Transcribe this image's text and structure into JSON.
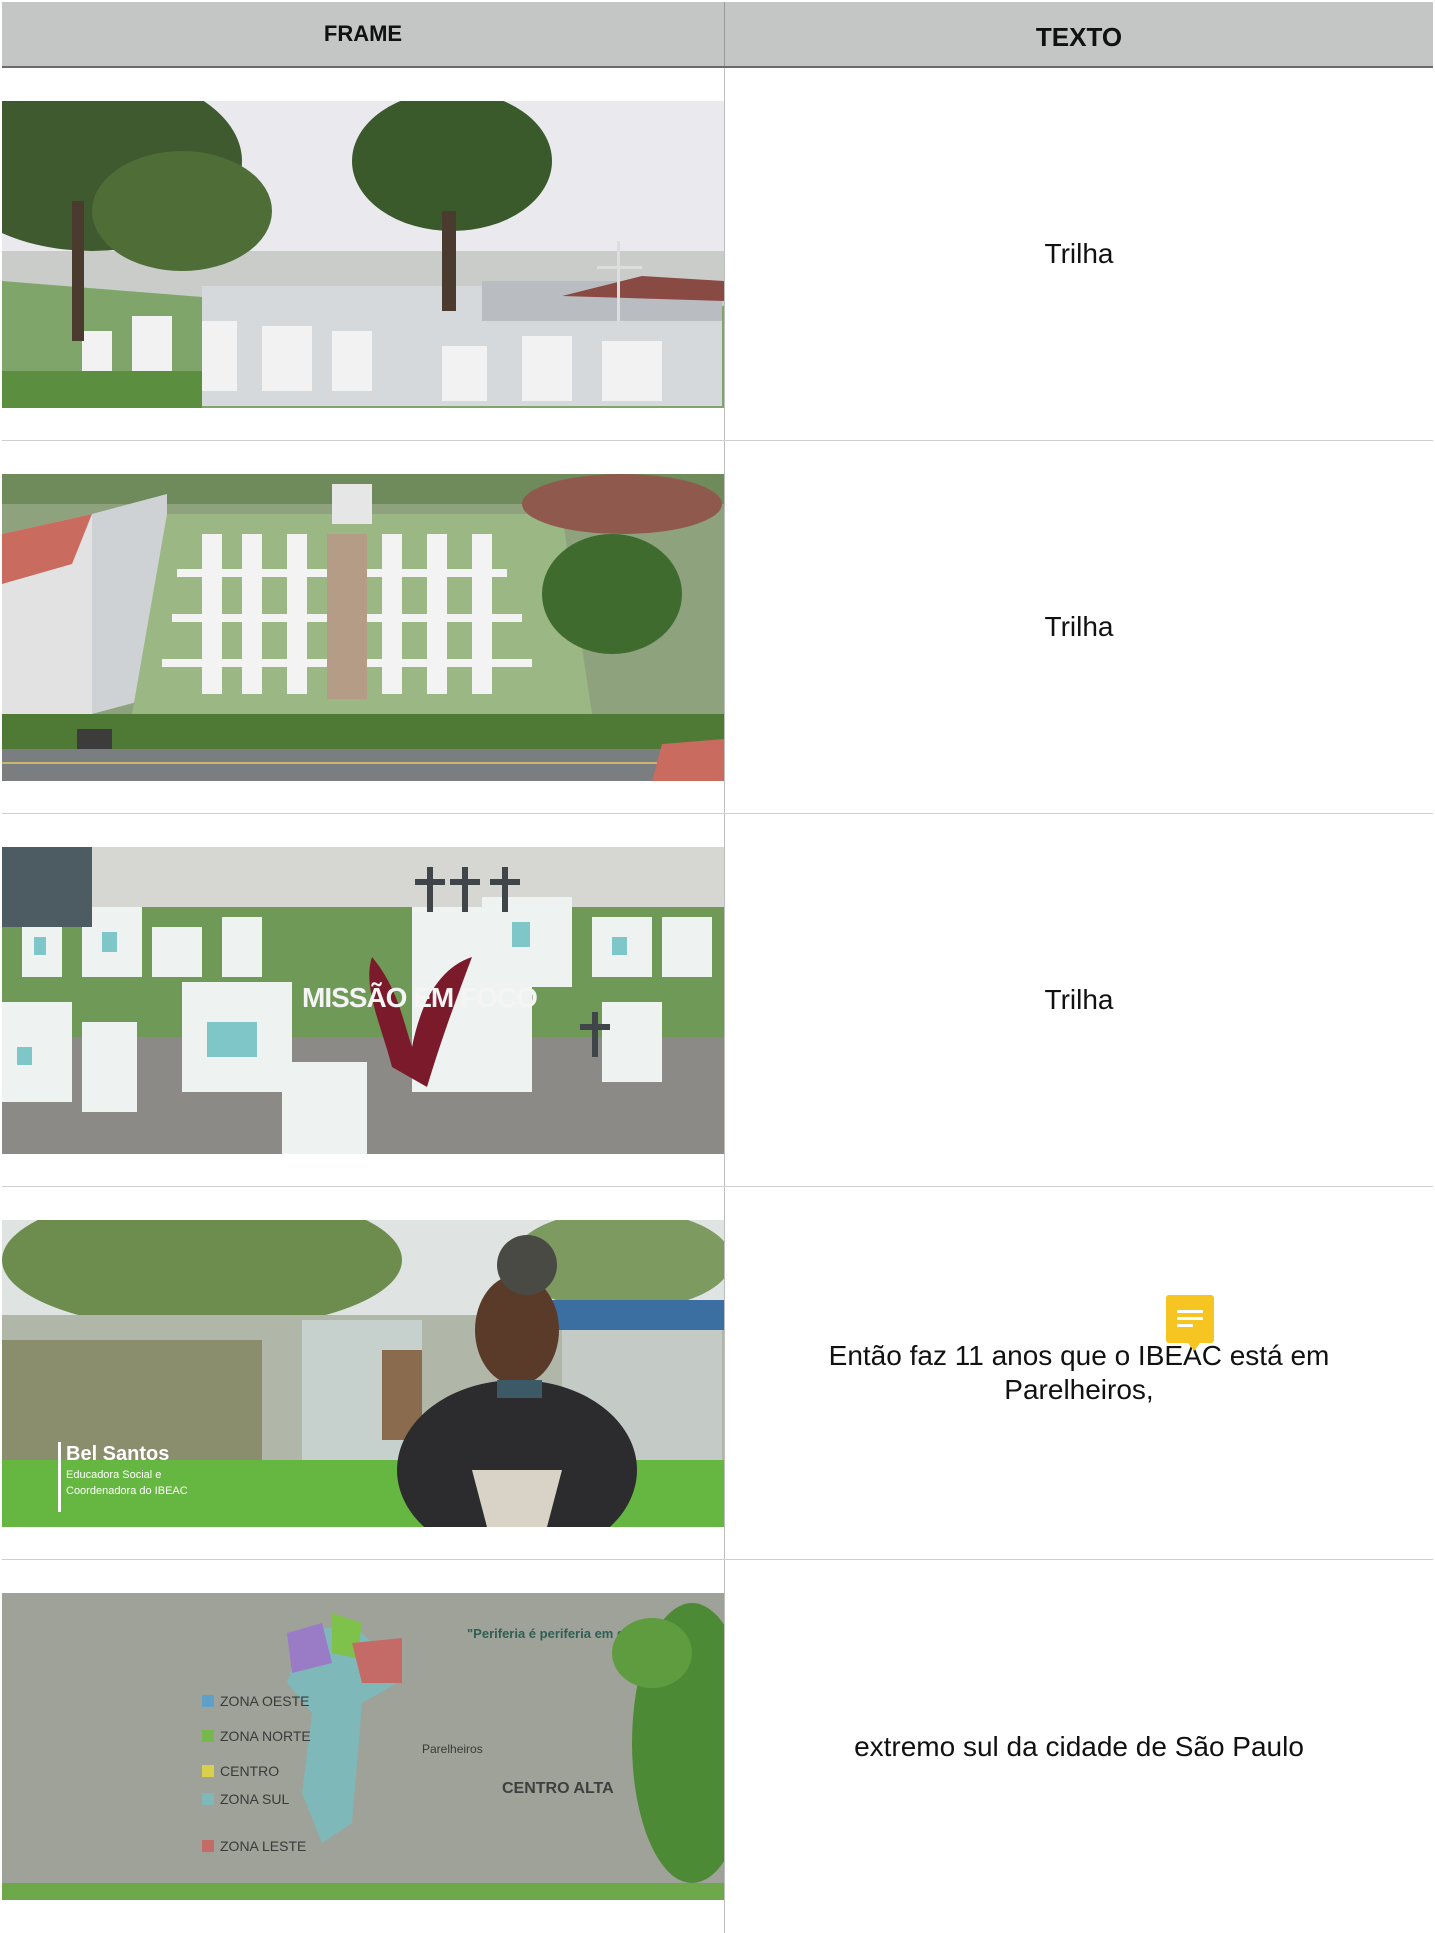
{
  "table": {
    "header": {
      "frame": "FRAME",
      "texto": "TEXTO"
    },
    "rows": [
      {
        "frame": "cemetery-trees-wide-shot",
        "texto": "Trilha"
      },
      {
        "frame": "cemetery-aerial-shot",
        "texto": "Trilha"
      },
      {
        "frame": "cemetery-graves-title-card",
        "texto": "Trilha",
        "overlay_title": "MISSÃO EM FOCO"
      },
      {
        "frame": "interview-woman-seated",
        "texto": "Então faz 11 anos que o IBEAC está em Parelheiros,",
        "lower_third_name": "Bel Santos",
        "lower_third_role_1": "Educadora Social e",
        "lower_third_role_2": "Coordenadora do IBEAC"
      },
      {
        "frame": "wall-map-mural",
        "texto": "extremo sul da cidade de São Paulo",
        "mural_legend": [
          "ZONA OESTE",
          "ZONA NORTE",
          "CENTRO",
          "ZONA SUL",
          "ZONA LESTE"
        ],
        "mural_quote": "\"Periferia é periferia em qualquer lugar\"",
        "mural_place": "Parelheiros",
        "mural_logo": "CENTRO ALTA"
      }
    ]
  },
  "comment_marker": {
    "icon": "comment-icon",
    "color": "#f6c521"
  }
}
